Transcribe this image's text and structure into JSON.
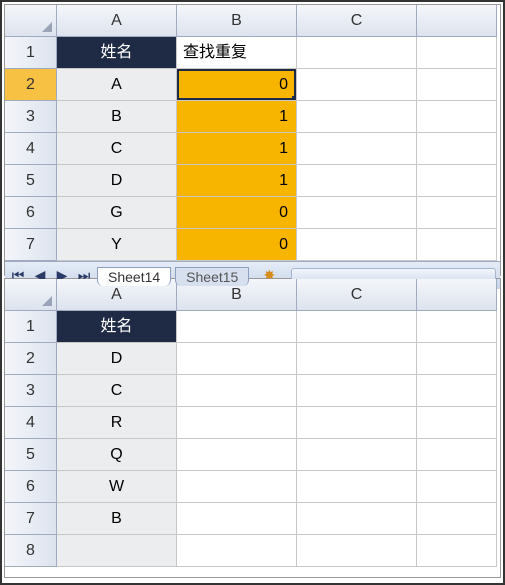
{
  "top": {
    "col_headers": [
      "A",
      "B",
      "C"
    ],
    "row_headers": [
      "1",
      "2",
      "3",
      "4",
      "5",
      "6",
      "7"
    ],
    "header_cells": {
      "A": "姓名",
      "B": "查找重复"
    },
    "rows": [
      {
        "A": "A",
        "B": "0"
      },
      {
        "A": "B",
        "B": "1"
      },
      {
        "A": "C",
        "B": "1"
      },
      {
        "A": "D",
        "B": "1"
      },
      {
        "A": "G",
        "B": "0"
      },
      {
        "A": "Y",
        "B": "0"
      }
    ],
    "tabs": {
      "active": "Sheet14",
      "inactive": "Sheet15"
    }
  },
  "bottom": {
    "col_headers": [
      "A",
      "B",
      "C"
    ],
    "row_headers": [
      "1",
      "2",
      "3",
      "4",
      "5",
      "6",
      "7",
      "8"
    ],
    "header_cells": {
      "A": "姓名"
    },
    "rows": [
      {
        "A": "D"
      },
      {
        "A": "C"
      },
      {
        "A": "R"
      },
      {
        "A": "Q"
      },
      {
        "A": "W"
      },
      {
        "A": "B"
      }
    ]
  },
  "chart_data": [
    {
      "type": "table",
      "title": "Sheet14",
      "columns": [
        "姓名",
        "查找重复"
      ],
      "rows": [
        [
          "A",
          0
        ],
        [
          "B",
          1
        ],
        [
          "C",
          1
        ],
        [
          "D",
          1
        ],
        [
          "G",
          0
        ],
        [
          "Y",
          0
        ]
      ]
    },
    {
      "type": "table",
      "title": "Sheet15",
      "columns": [
        "姓名"
      ],
      "rows": [
        [
          "D"
        ],
        [
          "C"
        ],
        [
          "R"
        ],
        [
          "Q"
        ],
        [
          "W"
        ],
        [
          "B"
        ]
      ]
    }
  ]
}
